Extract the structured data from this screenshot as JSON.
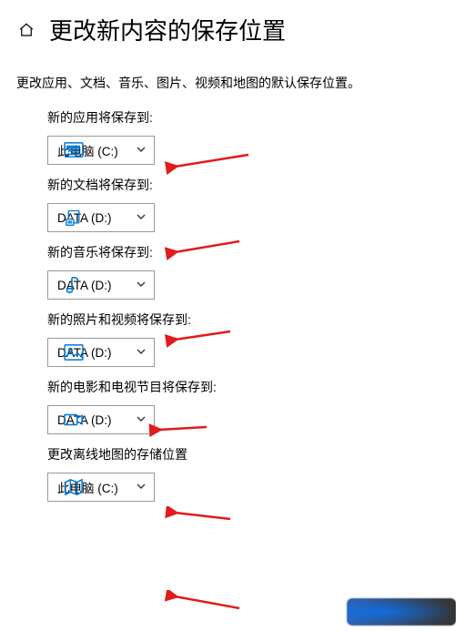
{
  "header": {
    "title": "更改新内容的保存位置"
  },
  "subheader": "更改应用、文档、音乐、图片、视频和地图的默认保存位置。",
  "sections": [
    {
      "label": "新的应用将保存到:",
      "value": "此电脑 (C:)",
      "icon": "apps-icon"
    },
    {
      "label": "新的文档将保存到:",
      "value": "DATA (D:)",
      "icon": "documents-icon"
    },
    {
      "label": "新的音乐将保存到:",
      "value": "DATA (D:)",
      "icon": "music-icon"
    },
    {
      "label": "新的照片和视频将保存到:",
      "value": "DATA (D:)",
      "icon": "photos-icon"
    },
    {
      "label": "新的电影和电视节目将保存到:",
      "value": "DATA (D:)",
      "icon": "movies-icon"
    },
    {
      "label": "更改离线地图的存储位置",
      "value": "此电脑 (C:)",
      "icon": "maps-icon"
    }
  ],
  "accent": "#0078D7"
}
